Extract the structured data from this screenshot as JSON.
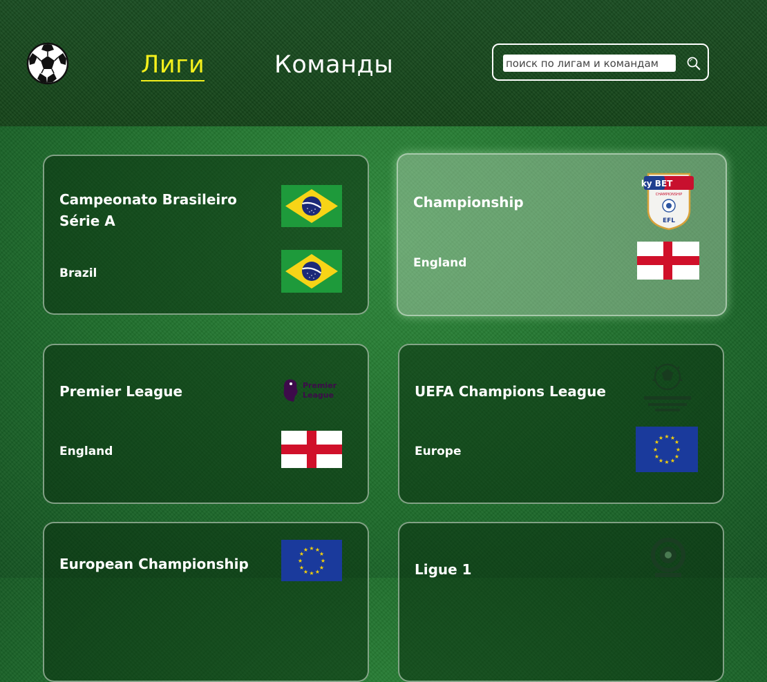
{
  "nav": {
    "leagues_label": "Лиги",
    "teams_label": "Команды"
  },
  "search": {
    "placeholder": "поиск по лигам и командам"
  },
  "cards": [
    {
      "title": "Campeonato Brasileiro Série A",
      "country": "Brazil",
      "logo": "brazil-flag",
      "flag": "brazil-flag"
    },
    {
      "title": "Championship",
      "country": "England",
      "logo": "sky-bet-championship-logo",
      "logo_text": "sky BET",
      "logo_sub": "CHAMPIONSHIP",
      "logo_badge": "EFL",
      "flag": "england-flag"
    },
    {
      "title": "Premier League",
      "country": "England",
      "logo": "premier-league-logo",
      "logo_text": "Premier League",
      "flag": "england-flag"
    },
    {
      "title": "UEFA Champions League",
      "country": "Europe",
      "logo": "champions-league-logo",
      "flag": "eu-flag"
    },
    {
      "title": "European Championship",
      "country": "",
      "logo": "eu-flag",
      "flag": ""
    },
    {
      "title": "Ligue 1",
      "country": "",
      "logo": "ligue-1-logo",
      "flag": ""
    }
  ],
  "colors": {
    "active_nav": "#f4f01c",
    "card_border": "#dcebdc",
    "brazil_green": "#1e9a3b",
    "brazil_yellow": "#f7d417",
    "england_red": "#d0102a",
    "eu_blue": "#1a3a9c",
    "eu_star": "#f5d10a"
  }
}
